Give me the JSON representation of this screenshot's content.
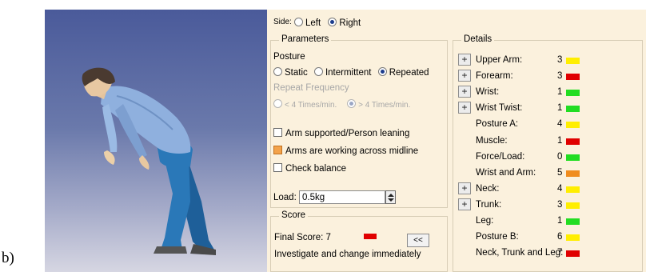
{
  "figure_label": "b)",
  "side": {
    "label": "Side:",
    "options": [
      {
        "label": "Left",
        "selected": false
      },
      {
        "label": "Right",
        "selected": true
      }
    ]
  },
  "parameters": {
    "title": "Parameters",
    "posture_label": "Posture",
    "posture_options": [
      {
        "label": "Static",
        "selected": false
      },
      {
        "label": "Intermittent",
        "selected": false
      },
      {
        "label": "Repeated",
        "selected": true
      }
    ],
    "repeat_frequency_label": "Repeat Frequency",
    "frequency_options": [
      {
        "label": "< 4 Times/min.",
        "selected": false
      },
      {
        "label": "> 4 Times/min.",
        "selected": true
      }
    ],
    "checkboxes": [
      {
        "label": "Arm supported/Person leaning",
        "checked": false
      },
      {
        "label": "Arms are working across midline",
        "checked": true
      },
      {
        "label": "Check balance",
        "checked": false
      }
    ],
    "load_label": "Load:",
    "load_value": "0.5kg"
  },
  "score": {
    "title": "Score",
    "final_score_text": "Final Score: 7",
    "final_score_color": "#e00000",
    "back_button_label": "<<",
    "message": "Investigate and change immediately"
  },
  "details": {
    "title": "Details",
    "rows": [
      {
        "label": "Upper Arm:",
        "value": "3",
        "color": "#ffee00",
        "expandable": true
      },
      {
        "label": "Forearm:",
        "value": "3",
        "color": "#e00000",
        "expandable": true
      },
      {
        "label": "Wrist:",
        "value": "1",
        "color": "#22dd22",
        "expandable": true
      },
      {
        "label": "Wrist Twist:",
        "value": "1",
        "color": "#22dd22",
        "expandable": true
      },
      {
        "label": "Posture A:",
        "value": "4",
        "color": "#ffee00",
        "expandable": false
      },
      {
        "label": "Muscle:",
        "value": "1",
        "color": "#e00000",
        "expandable": false
      },
      {
        "label": "Force/Load:",
        "value": "0",
        "color": "#22dd22",
        "expandable": false
      },
      {
        "label": "Wrist and Arm:",
        "value": "5",
        "color": "#f08c1e",
        "expandable": false
      },
      {
        "label": "Neck:",
        "value": "4",
        "color": "#ffee00",
        "expandable": true
      },
      {
        "label": "Trunk:",
        "value": "3",
        "color": "#ffee00",
        "expandable": true
      },
      {
        "label": "Leg:",
        "value": "1",
        "color": "#22dd22",
        "expandable": false
      },
      {
        "label": "Posture B:",
        "value": "6",
        "color": "#ffee00",
        "expandable": false
      },
      {
        "label": "Neck, Trunk and Leg:",
        "value": "7",
        "color": "#e00000",
        "expandable": false
      }
    ]
  },
  "icons": {
    "plus": "expand-plus-icon",
    "spinner": "spinner-arrows-icon"
  }
}
